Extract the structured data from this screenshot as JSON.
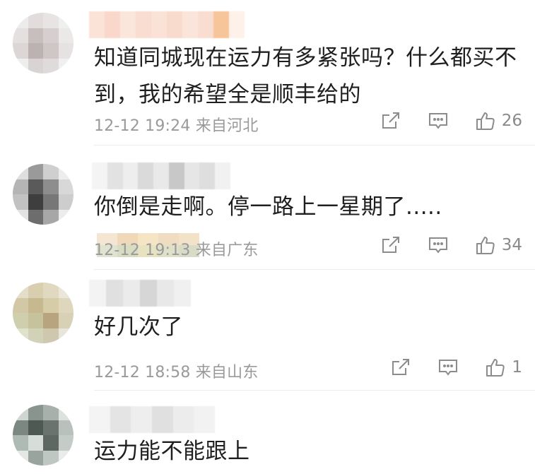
{
  "comments": [
    {
      "text_line1": "知道同城现在运力有多紧张吗？什么都买不",
      "text_line2": "到，我的希望全是顺丰给的",
      "time": "12-12 19:24",
      "location": "来自河北",
      "likes": "26"
    },
    {
      "text_line1": "你倒是走啊。停一路上一星期了.....",
      "time": "12-12 19:13",
      "location": "来自广东",
      "likes": "34"
    },
    {
      "text_line1": "好几次了",
      "time": "12-12 18:58",
      "location": "来自山东",
      "likes": "1"
    },
    {
      "text_line1": "运力能不能跟上"
    }
  ],
  "icons": {
    "share": "share-icon",
    "comment": "comment-icon",
    "like": "thumbs-up-icon"
  },
  "colors": {
    "meta_text": "#9a9a9a",
    "icon_stroke": "#8c8c8c"
  }
}
